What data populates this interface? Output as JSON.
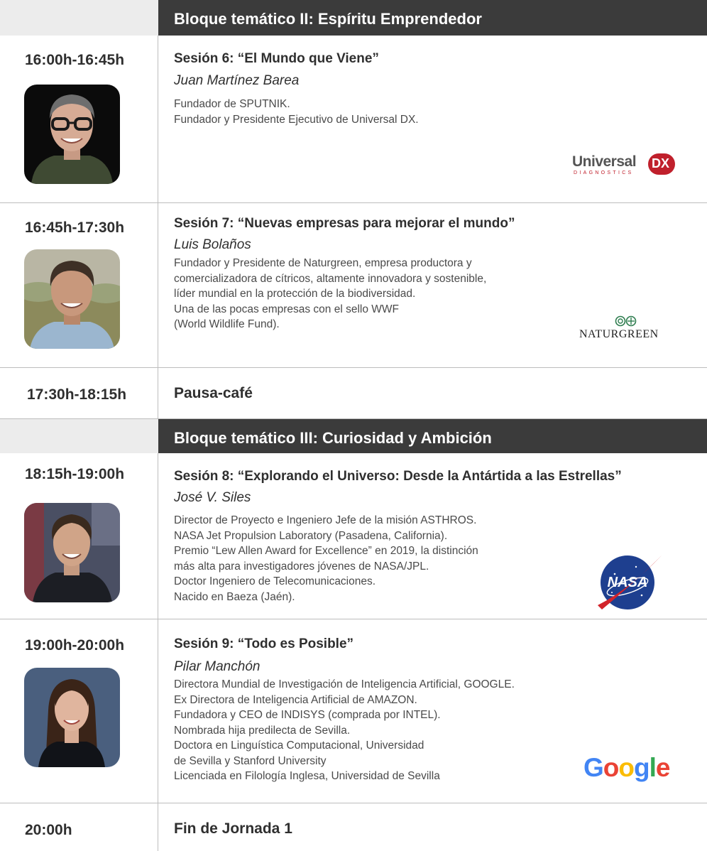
{
  "blocks": {
    "b2_title": "Bloque temático II: Espíritu Emprendedor",
    "b3_title": "Bloque temático III: Curiosidad y Ambición"
  },
  "sessions": [
    {
      "time": "16:00h-16:45h",
      "title": "Sesión 6: “El Mundo que Viene”",
      "speaker": "Juan Martínez Barea",
      "desc": [
        "Fundador de SPUTNIK.",
        "Fundador y Presidente Ejecutivo de Universal DX."
      ],
      "logo": {
        "main": "Universal",
        "mark": "DX",
        "sub": "DIAGNOSTICS",
        "icon": "universal-dx-logo",
        "color": "#c0202c"
      }
    },
    {
      "time": "16:45h-17:30h",
      "title": "Sesión 7: “Nuevas empresas para mejorar el mundo”",
      "speaker": "Luis Bolaños",
      "desc": [
        "Fundador y Presidente de Naturgreen, empresa productora y",
        "comercializadora de cítricos, altamente innovadora y sostenible,",
        "líder mundial en la protección de la biodiversidad.",
        "Una de las pocas empresas con el sello WWF",
        "(World Wildlife Fund)."
      ],
      "logo": {
        "text": "NATURGREEN",
        "icon": "naturgreen-logo",
        "color": "#2e7d4f"
      }
    },
    {
      "time": "18:15h-19:00h",
      "title": "Sesión 8: “Explorando el Universo: Desde la Antártida a las Estrellas”",
      "speaker": "José V. Siles",
      "desc": [
        "Director de Proyecto e Ingeniero Jefe de la misión ASTHROS.",
        "NASA Jet Propulsion Laboratory (Pasadena, California).",
        "Premio “Lew Allen Award for Excellence” en 2019, la distinción",
        "más alta para investigadores jóvenes de NASA/JPL.",
        "Doctor Ingeniero de Telecomunicaciones.",
        "Nacido en Baeza (Jaén)."
      ],
      "logo": {
        "text": "NASA",
        "icon": "nasa-logo",
        "color": "#1e3f8f"
      }
    },
    {
      "time": "19:00h-20:00h",
      "title": "Sesión 9: “Todo es Posible”",
      "speaker": "Pilar Manchón",
      "desc": [
        "Directora Mundial de Investigación de Inteligencia Artificial, GOOGLE.",
        "Ex Directora de Inteligencia Artificial de AMAZON.",
        "Fundadora y CEO de INDISYS (comprada por INTEL).",
        "Nombrada hija predilecta de Sevilla.",
        "Doctora en Linguística Computacional, Universidad",
        "de Sevilla y Stanford University",
        "Licenciada en Filología Inglesa, Universidad de Sevilla"
      ],
      "logo": {
        "letters": [
          "G",
          "o",
          "o",
          "g",
          "l",
          "e"
        ],
        "icon": "google-logo",
        "colors": [
          "#4285F4",
          "#EA4335",
          "#FBBC05",
          "#4285F4",
          "#34A853",
          "#EA4335"
        ]
      }
    }
  ],
  "breaks": {
    "coffee_time": "17:30h-18:15h",
    "coffee_label": "Pausa-café",
    "end_time": "20:00h",
    "end_label": "Fin de Jornada 1"
  },
  "colors": {
    "header_bg": "#3b3b3b",
    "border": "#bdbdbd"
  }
}
